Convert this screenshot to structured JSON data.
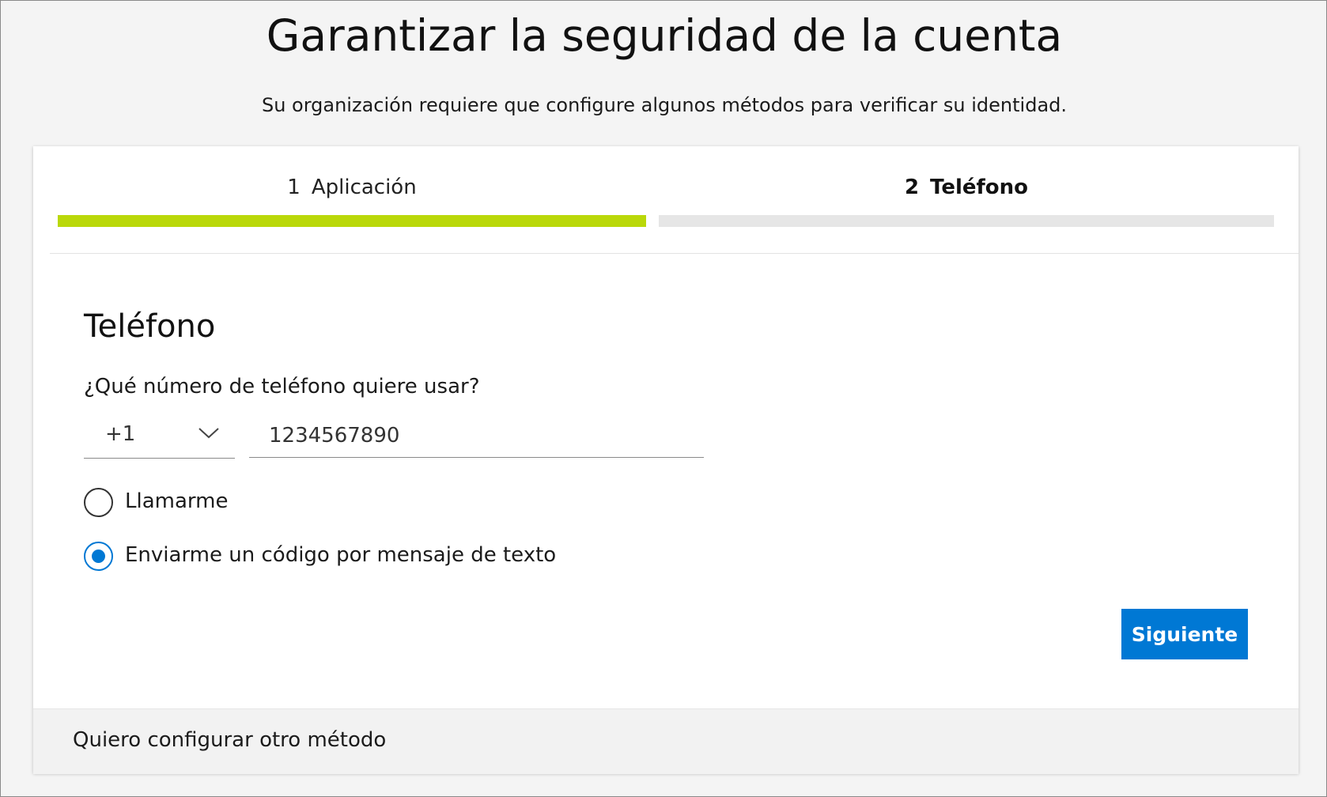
{
  "header": {
    "title": "Garantizar la seguridad de la cuenta",
    "subtitle": "Su organización requiere que configure algunos métodos para verificar su identidad."
  },
  "steps": [
    {
      "number": "1",
      "label": "Aplicación",
      "state": "completed"
    },
    {
      "number": "2",
      "label": "Teléfono",
      "state": "current"
    }
  ],
  "form": {
    "section_title": "Teléfono",
    "question": "¿Qué número de teléfono quiere usar?",
    "country_code": "+1",
    "phone_number": "1234567890",
    "options": [
      {
        "label": "Llamarme",
        "selected": false
      },
      {
        "label": "Enviarme un código por mensaje de texto",
        "selected": true
      }
    ],
    "next_label": "Siguiente"
  },
  "footer": {
    "other_method_label": "Quiero configurar otro método"
  },
  "colors": {
    "accent": "#0078d4",
    "progress_done": "#bad80a",
    "progress_pending": "#e6e6e6",
    "page_background": "#f4f4f4"
  },
  "icons": {
    "country_dropdown": "chevron-down-icon"
  }
}
